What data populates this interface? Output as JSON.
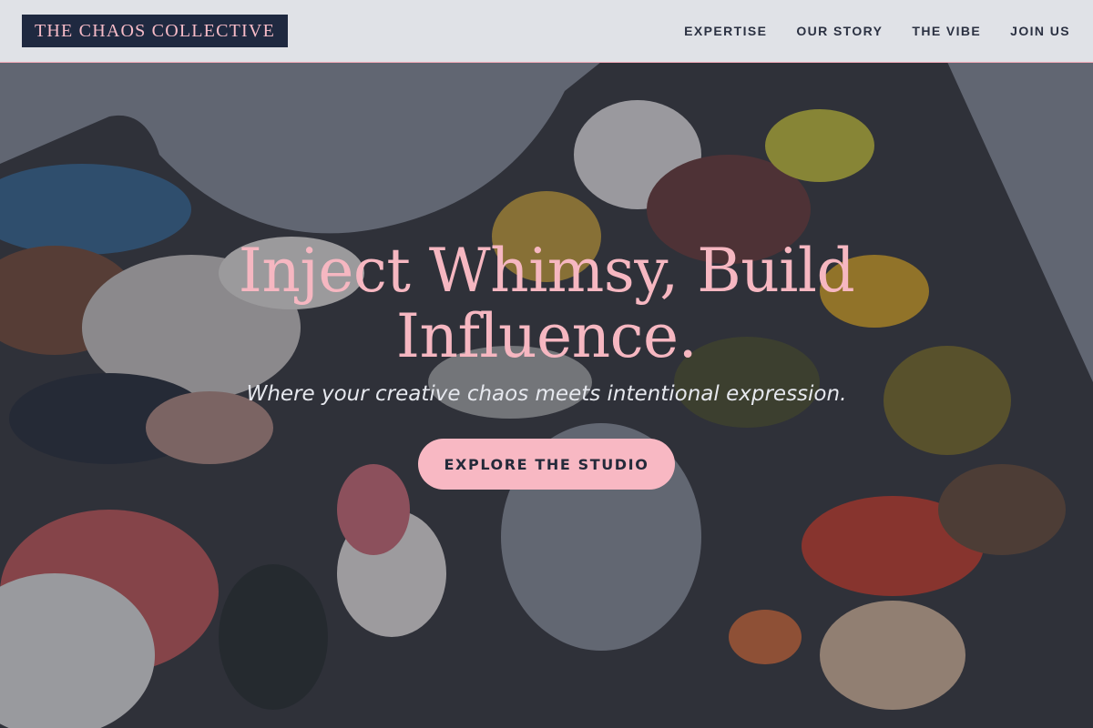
{
  "header": {
    "brand": "THE CHAOS COLLECTIVE",
    "nav": [
      {
        "label": "EXPERTISE"
      },
      {
        "label": "OUR STORY"
      },
      {
        "label": "THE VIBE"
      },
      {
        "label": "JOIN US"
      }
    ]
  },
  "hero": {
    "title": "Inject Whimsy, Build Influence.",
    "subtitle": "Where your creative chaos meets intentional expression.",
    "cta_label": "EXPLORE THE STUDIO",
    "background_description": "dark overlay on a photo of a paint-smeared artist palette"
  },
  "colors": {
    "accent_pink": "#f8b8c3",
    "brand_navy": "#1f2940",
    "nav_text": "#2b3142",
    "header_border": "#f1a9b8"
  }
}
